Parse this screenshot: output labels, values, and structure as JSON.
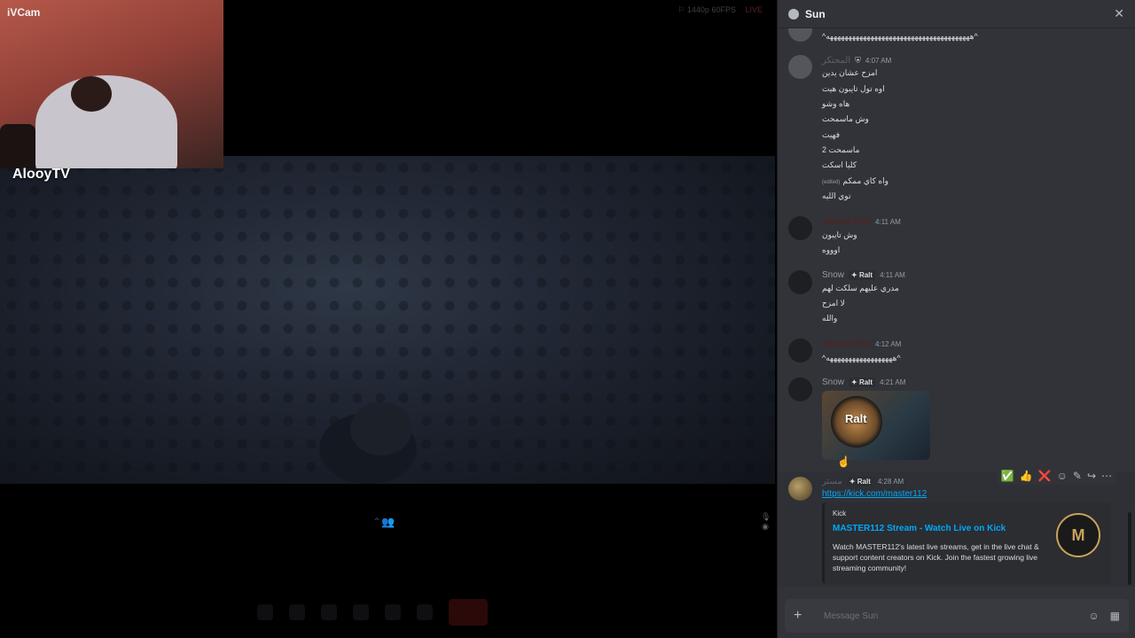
{
  "webcam": {
    "title": "iVCam",
    "name": "AlooyTV"
  },
  "stream": {
    "badge": "⚐ 1440p 60FPS",
    "live": "LIVE"
  },
  "chat": {
    "title": "Sun",
    "close_icon": "close-icon",
    "top_line": "^هههههههههههههههههههههههههههههههههههههههه^",
    "messages": [
      {
        "user": "المحتكر",
        "time": "4:07 AM",
        "lines": [
          "امزح عشان يدين",
          "اوه تول تايبون هيت",
          "هاه وشو",
          "وش ماسمحت",
          "فهيت",
          "ماسمحت 2",
          "كليا اسكت",
          "واه كاي ممكم",
          "توي الليه"
        ],
        "edited_label": "(edited)"
      },
      {
        "user": "Ahmed Elnfr",
        "time": "4:11 AM",
        "lines": [
          "وش تايبون",
          "اوووه"
        ]
      },
      {
        "user": "Snow",
        "tag": "✦ Ralt",
        "time": "4:11 AM",
        "lines": [
          "مدري عليهم سلكت لهم",
          "لا امزح",
          "والله"
        ]
      },
      {
        "user": "Ahmed Elnfr",
        "time": "4:12 AM",
        "lines": [
          "^ههههههههههههههههههه^"
        ]
      },
      {
        "user": "Snow",
        "tag": "✦ Ralt",
        "time": "4:21 AM",
        "sticker_text": "Ralt"
      },
      {
        "user": "مستر",
        "tag": "✦ Ralt",
        "time": "4:28 AM",
        "link": "https://kick.com/master112",
        "embed": {
          "provider": "Kick",
          "title": "MASTER112 Stream - Watch Live on Kick",
          "description": "Watch MASTER112's latest live streams, get in the live chat & support content creators on Kick. Join the fastest growing live streaming community!",
          "logo": "M"
        }
      }
    ],
    "toolbar": [
      "✅",
      "👍",
      "❌",
      "☺",
      "✎",
      "↪",
      "⋯"
    ],
    "composer": {
      "placeholder": "Message Sun",
      "plus": "+",
      "emoji": "☺",
      "apps": "▦"
    }
  }
}
